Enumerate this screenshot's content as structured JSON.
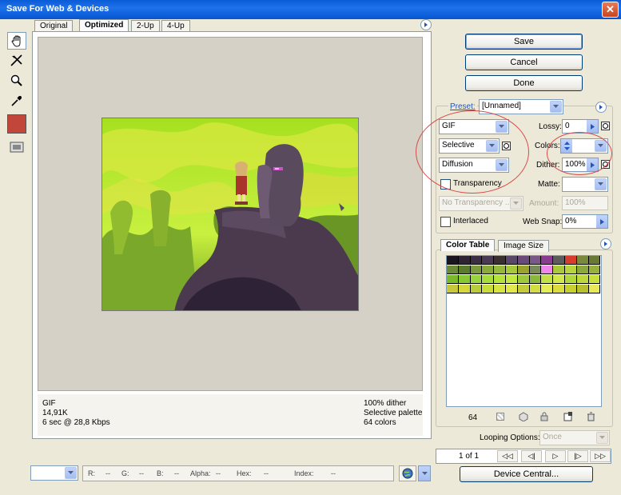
{
  "window": {
    "title": "Save For Web & Devices"
  },
  "tabs": [
    "Original",
    "Optimized",
    "2-Up",
    "4-Up"
  ],
  "info_left": {
    "format": "GIF",
    "size": "14,91K",
    "time": "6 sec @ 28,8 Kbps"
  },
  "info_right": {
    "dither": "100% dither",
    "palette": "Selective palette",
    "colors": "64 colors"
  },
  "buttons": {
    "save": "Save",
    "cancel": "Cancel",
    "done": "Done",
    "device_central": "Device Central..."
  },
  "preset": {
    "label": "Preset:",
    "value": "[Unnamed]"
  },
  "settings": {
    "format": "GIF",
    "reduction": "Selective",
    "dither_algo": "Diffusion",
    "transparency_label": "Transparency",
    "transparency_dither": "No Transparency ...",
    "interlaced_label": "Interlaced",
    "lossy_label": "Lossy:",
    "lossy_value": "0",
    "colors_label": "Colors:",
    "colors_value": "",
    "dither_label": "Dither:",
    "dither_value": "100%",
    "matte_label": "Matte:",
    "matte_value": "",
    "amount_label": "Amount:",
    "amount_value": "100%",
    "websnap_label": "Web Snap:",
    "websnap_value": "0%"
  },
  "panel_tabs": {
    "color_table": "Color Table",
    "image_size": "Image Size"
  },
  "color_table": {
    "count": "64",
    "rows": [
      [
        "#1a1620",
        "#2e2434",
        "#3c2f44",
        "#4a3a54",
        "#3a3030",
        "#5a4868",
        "#6a4a7a",
        "#7a5888",
        "#8a3c8e",
        "#5c5c5c",
        "#d83c2c",
        "#7a8a3c",
        "#6a7a34"
      ],
      [
        "#6a8a38",
        "#5a7a2c",
        "#7a9a3c",
        "#8aaa3c",
        "#96b83c",
        "#a8c83c",
        "#9aa42c",
        "#7a8a58",
        "#ee88e8",
        "#aac83c",
        "#b8d43c",
        "#8ca83c",
        "#98b03c"
      ],
      [
        "#7ab82c",
        "#88c832",
        "#98d43c",
        "#a8dc3c",
        "#b4e43c",
        "#c0e840",
        "#a0c83c",
        "#8ab83c",
        "#c4e048",
        "#d0e84c",
        "#b0d83c",
        "#bcd83c",
        "#c8e03c"
      ],
      [
        "#c8c83c",
        "#d4d83c",
        "#b8cc3c",
        "#c8dc3c",
        "#d8e440",
        "#e0e84c",
        "#c4cc3c",
        "#d4dc44",
        "#e4ec58",
        "#dcdc3c",
        "#c8d030",
        "#b8c030",
        "#e8e858"
      ]
    ]
  },
  "looping": {
    "label": "Looping Options:",
    "value": "Once"
  },
  "frame": {
    "counter": "1 of 1"
  },
  "status_bar": {
    "zoom": "",
    "r": "R:",
    "r_val": "--",
    "g": "G:",
    "g_val": "--",
    "b": "B:",
    "b_val": "--",
    "alpha": "Alpha:",
    "alpha_val": "--",
    "hex": "Hex:",
    "hex_val": "--",
    "index": "Index:",
    "index_val": "--"
  }
}
